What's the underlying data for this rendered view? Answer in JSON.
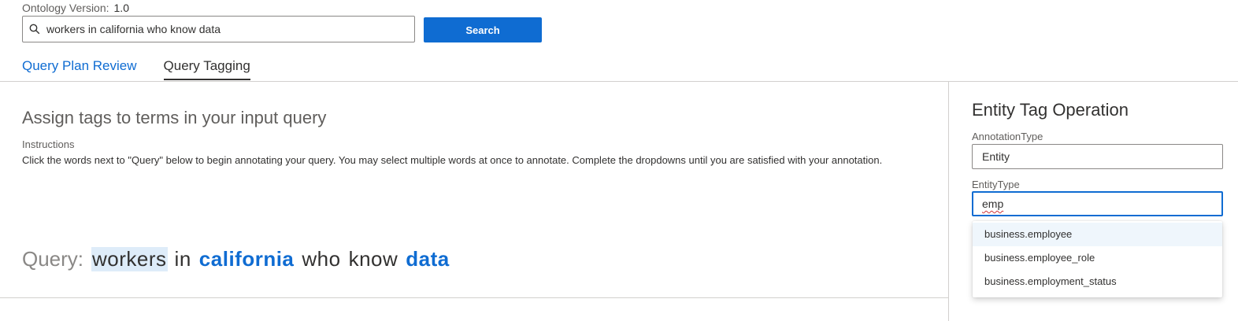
{
  "header": {
    "ontology_label": "Ontology Version:",
    "ontology_value": "1.0"
  },
  "search": {
    "value": "workers in california who know data",
    "button_label": "Search",
    "icon": "search-icon"
  },
  "tabs": [
    {
      "label": "Query Plan Review",
      "active": false
    },
    {
      "label": "Query Tagging",
      "active": true
    }
  ],
  "main": {
    "heading": "Assign tags to terms in your input query",
    "instructions_label": "Instructions",
    "instructions_text": "Click the words next to \"Query\" below to begin annotating your query. You may select multiple words at once to annotate. Complete the dropdowns until you are satisfied with your annotation.",
    "query_label": "Query:",
    "query_words": [
      {
        "text": "workers",
        "state": "selected"
      },
      {
        "text": "in",
        "state": "plain"
      },
      {
        "text": "california",
        "state": "tagged"
      },
      {
        "text": "who",
        "state": "plain"
      },
      {
        "text": "know",
        "state": "plain"
      },
      {
        "text": "data",
        "state": "tagged"
      }
    ]
  },
  "panel": {
    "title": "Entity Tag Operation",
    "annotation_type_label": "AnnotationType",
    "annotation_type_value": "Entity",
    "entity_type_label": "EntityType",
    "entity_type_value": "emp",
    "options": [
      "business.employee",
      "business.employee_role",
      "business.employment_status"
    ]
  },
  "colors": {
    "accent": "#0f6cd2",
    "selected_bg": "#deecf9",
    "border": "#d2d0ce"
  }
}
